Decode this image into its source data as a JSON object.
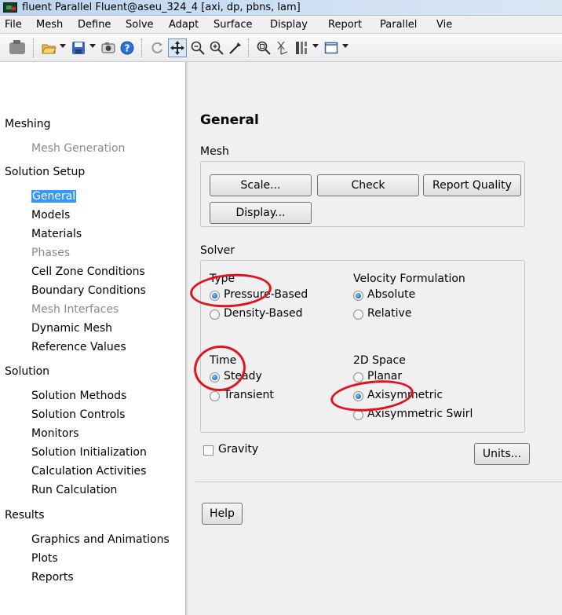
{
  "window": {
    "title": "fluent Parallel Fluent@aseu_324_4  [axi, dp, pbns, lam]"
  },
  "menu": [
    "File",
    "Mesh",
    "Define",
    "Solve",
    "Adapt",
    "Surface",
    "Display",
    "Report",
    "Parallel",
    "Vie"
  ],
  "toolbar_icons": [
    "mesh-display-icon",
    "open-icon",
    "save-icon",
    "camera-icon",
    "help-icon",
    "rotate-icon",
    "pan-icon",
    "zoom-icon",
    "zoom-in-icon",
    "probe-icon",
    "zoom-fit-icon",
    "coordinates-icon",
    "layout-icon",
    "window-icon"
  ],
  "nav": {
    "items": [
      {
        "label": "Meshing",
        "kind": "category"
      },
      {
        "label": "Mesh Generation",
        "kind": "disabled"
      },
      {
        "label": "Solution Setup",
        "kind": "category"
      },
      {
        "label": "General",
        "kind": "selected"
      },
      {
        "label": "Models",
        "kind": "sub"
      },
      {
        "label": "Materials",
        "kind": "sub"
      },
      {
        "label": "Phases",
        "kind": "disabled"
      },
      {
        "label": "Cell Zone Conditions",
        "kind": "sub"
      },
      {
        "label": "Boundary Conditions",
        "kind": "sub"
      },
      {
        "label": "Mesh Interfaces",
        "kind": "disabled"
      },
      {
        "label": "Dynamic Mesh",
        "kind": "sub"
      },
      {
        "label": "Reference Values",
        "kind": "sub"
      },
      {
        "label": "Solution",
        "kind": "category"
      },
      {
        "label": "Solution Methods",
        "kind": "sub"
      },
      {
        "label": "Solution Controls",
        "kind": "sub"
      },
      {
        "label": "Monitors",
        "kind": "sub"
      },
      {
        "label": "Solution Initialization",
        "kind": "sub"
      },
      {
        "label": "Calculation Activities",
        "kind": "sub"
      },
      {
        "label": "Run Calculation",
        "kind": "sub"
      },
      {
        "label": "Results",
        "kind": "category"
      },
      {
        "label": "Graphics and Animations",
        "kind": "sub"
      },
      {
        "label": "Plots",
        "kind": "sub"
      },
      {
        "label": "Reports",
        "kind": "sub"
      }
    ]
  },
  "page": {
    "title": "General",
    "mesh": {
      "label": "Mesh",
      "scale": "Scale...",
      "check": "Check",
      "report_quality": "Report Quality",
      "display": "Display..."
    },
    "solver": {
      "label": "Solver",
      "type_label": "Type",
      "pressure_based": "Pressure-Based",
      "density_based": "Density-Based",
      "type_selected": "Pressure-Based",
      "velocity_label": "Velocity Formulation",
      "absolute": "Absolute",
      "relative": "Relative",
      "velocity_selected": "Absolute",
      "time_label": "Time",
      "steady": "Steady",
      "transient": "Transient",
      "time_selected": "Steady",
      "space_label": "2D Space",
      "planar": "Planar",
      "axisymmetric": "Axisymmetric",
      "axisymmetric_swirl": "Axisymmetric Swirl",
      "space_selected": "Axisymmetric"
    },
    "gravity": {
      "label": "Gravity",
      "checked": false
    },
    "units": "Units...",
    "help": "Help"
  },
  "colors": {
    "selection": "#3399ff",
    "annotation": "#e0141e",
    "panel": "#f0f0f0"
  }
}
